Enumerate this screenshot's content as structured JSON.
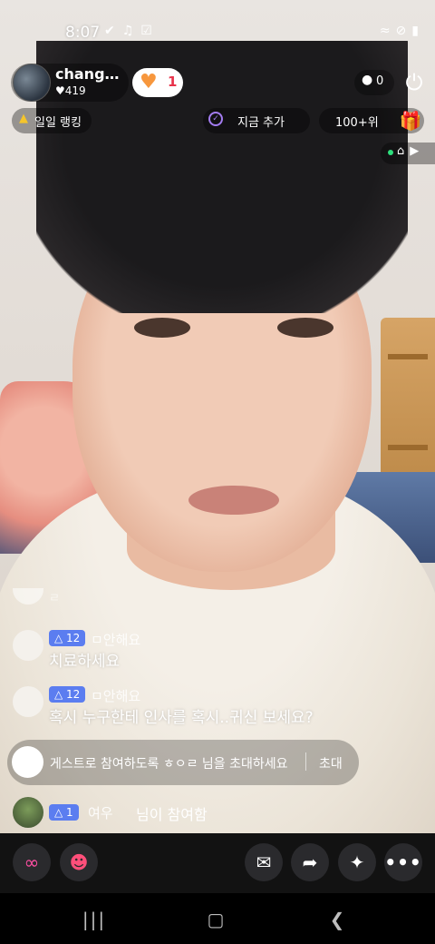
{
  "status_bar": {
    "time": "8:07",
    "left_icons": [
      "notification-icon",
      "music-icon",
      "check-icon"
    ],
    "right_icons": [
      "wifi-icon",
      "no-signal-icon",
      "battery-icon"
    ]
  },
  "host": {
    "name": "changh...",
    "likes": "419",
    "follow_count": "1"
  },
  "viewers": {
    "count": "0"
  },
  "top_row": {
    "ranking_label": "일일 랭킹",
    "add_label": "지금 추가",
    "rank_position": "100+위"
  },
  "chat": {
    "messages": [
      {
        "badge": "12",
        "user": "ㅁ안해요",
        "text": "치료하세요"
      },
      {
        "badge": "12",
        "user": "ㅁ안해요",
        "text": "혹시 누구한테 인사를 혹시..귀신 보세요?"
      }
    ],
    "ghost_text": "ㄹ"
  },
  "invite": {
    "text": "게스트로 참여하도록 ㅎㅇㄹ 님을 초대하세요",
    "button": "초대"
  },
  "join": {
    "badge": "1",
    "user": "여우",
    "text": "님이 참여함"
  },
  "colors": {
    "badge_blue": "#5b7df0",
    "follow_heart": "#f7973d",
    "follow_count": "#e8334b",
    "accent_pink": "#ff4fa3"
  }
}
